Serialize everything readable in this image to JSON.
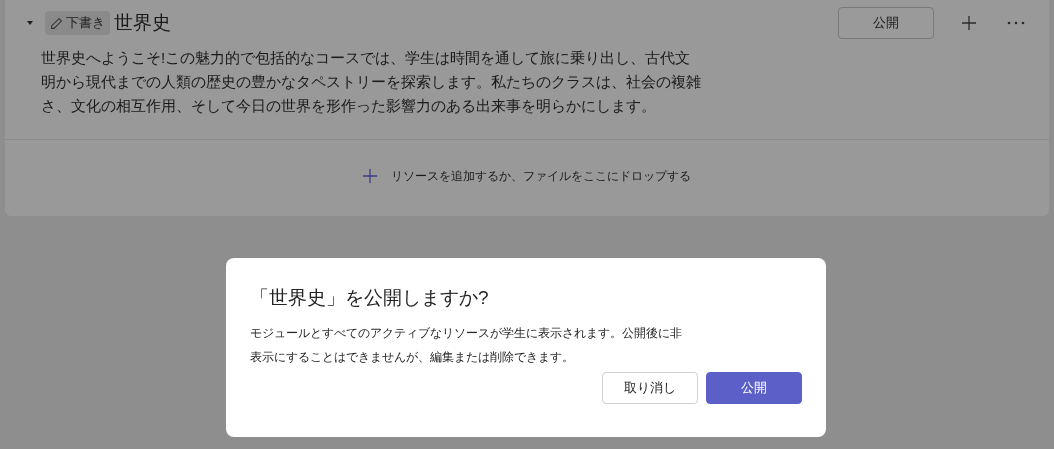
{
  "module": {
    "expanded": true,
    "badge": "下書き",
    "title": "世界史",
    "publish_button": "公開",
    "description": "世界史へようこそ!この魅力的で包括的なコースでは、学生は時間を通して旅に乗り出し、古代文明から現代までの人類の歴史の豊かなタペストリーを探索します。私たちのクラスは、社会の複雑さ、文化の相互作用、そして今日の世界を形作った影響力のある出来事を明らかにします。",
    "add_resource": "リソースを追加するか、ファイルをここにドロップする"
  },
  "dialog": {
    "title": "「世界史」を公開しますか?",
    "message": "モジュールとすべてのアクティブなリソースが学生に表示されます。公開後に非表示にすることはできませんが、編集または削除できます。",
    "buttons": [
      {
        "label": "取り消し",
        "kind": "secondary"
      },
      {
        "label": "公開",
        "kind": "primary"
      }
    ]
  }
}
